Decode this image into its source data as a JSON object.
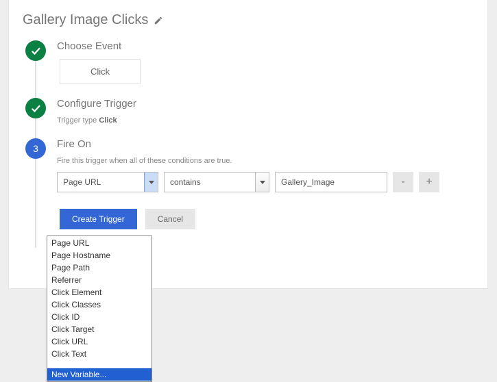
{
  "title": "Gallery Image Clicks",
  "steps": {
    "choose_event": {
      "title": "Choose Event",
      "value": "Click"
    },
    "configure_trigger": {
      "title": "Configure Trigger",
      "type_label": "Trigger type",
      "type_value": "Click"
    },
    "fire_on": {
      "number": "3",
      "title": "Fire On",
      "description": "Fire this trigger when all of these conditions are true.",
      "variable": "Page URL",
      "operator": "contains",
      "value": "Gallery_Image",
      "remove": "-",
      "add": "+"
    }
  },
  "footer": {
    "create": "Create Trigger",
    "cancel": "Cancel"
  },
  "dropdown": {
    "options": [
      "Page URL",
      "Page Hostname",
      "Page Path",
      "Referrer",
      "Click Element",
      "Click Classes",
      "Click ID",
      "Click Target",
      "Click URL",
      "Click Text"
    ],
    "new_variable": "New Variable..."
  }
}
